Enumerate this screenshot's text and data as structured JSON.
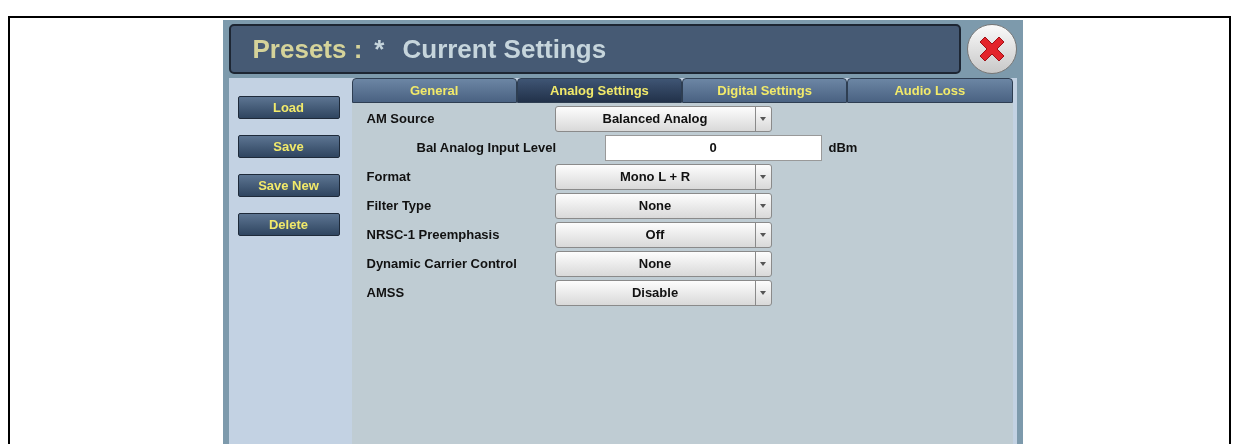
{
  "window": {
    "title_prefix": "Presets :",
    "title_marker": "*",
    "title": "Current Settings"
  },
  "actions": [
    "Load",
    "Save",
    "Save New",
    "Delete"
  ],
  "tabs": [
    {
      "label": "General",
      "selected": false
    },
    {
      "label": "Analog Settings",
      "selected": true
    },
    {
      "label": "Digital Settings",
      "selected": false
    },
    {
      "label": "Audio Loss",
      "selected": false
    }
  ],
  "fields": [
    {
      "kind": "dropdown",
      "label": "AM Source",
      "value": "Balanced Analog"
    },
    {
      "kind": "number",
      "label": "Bal Analog Input Level",
      "value": "0",
      "unit": "dBm"
    },
    {
      "kind": "dropdown",
      "label": "Format",
      "value": "Mono L + R"
    },
    {
      "kind": "dropdown",
      "label": "Filter Type",
      "value": "None"
    },
    {
      "kind": "dropdown",
      "label": "NRSC-1 Preemphasis",
      "value": "Off"
    },
    {
      "kind": "dropdown",
      "label": "Dynamic Carrier Control",
      "value": "None"
    },
    {
      "kind": "dropdown",
      "label": "AMSS",
      "value": "Disable"
    }
  ]
}
